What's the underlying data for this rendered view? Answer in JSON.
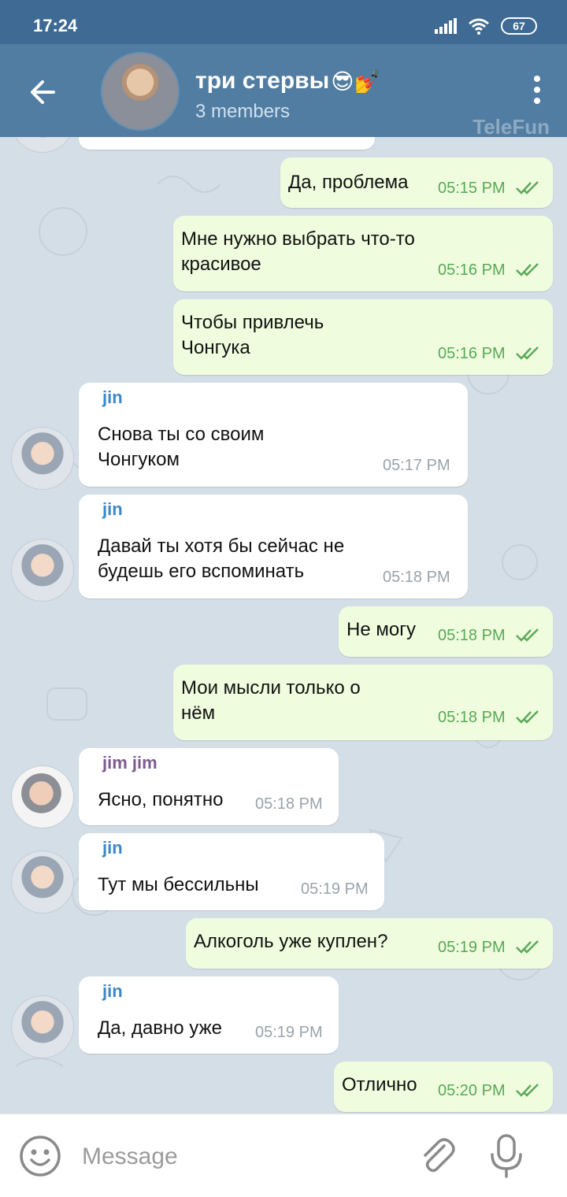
{
  "status": {
    "time": "17:24",
    "battery": "67"
  },
  "header": {
    "title": "три стервы",
    "title_emojis": "😎💅",
    "subtitle": "3 members",
    "watermark": "TeleFun"
  },
  "messages": [
    {
      "text": "Да, проблема",
      "time": "05:15 PM"
    },
    {
      "text": "Мне нужно выбрать что-то\nкрасивое",
      "time": "05:16 PM"
    },
    {
      "text": "Чтобы привлечь\nЧонгука",
      "time": "05:16 PM"
    },
    {
      "sender": "jin",
      "text": "Снова ты со своим\nЧонгуком",
      "time": "05:17 PM"
    },
    {
      "sender": "jin",
      "text": "Давай ты хотя бы сейчас не\nбудешь его вспоминать",
      "time": "05:18 PM"
    },
    {
      "text": "Не могу",
      "time": "05:18 PM"
    },
    {
      "text": "Мои мысли только о\nнём",
      "time": "05:18 PM"
    },
    {
      "sender": "jim jim",
      "text": "Ясно, понятно",
      "time": "05:18 PM"
    },
    {
      "sender": "jin",
      "text": "Тут мы бессильны",
      "time": "05:19 PM"
    },
    {
      "text": "Алкоголь уже куплен?",
      "time": "05:19 PM"
    },
    {
      "sender": "jin",
      "text": "Да, давно уже",
      "time": "05:19 PM"
    },
    {
      "text": "Отлично",
      "time": "05:20 PM"
    }
  ],
  "composer": {
    "placeholder": "Message"
  },
  "colors": {
    "header": "#517da2",
    "statusbar": "#3e6a93",
    "outgoing": "#effdde",
    "incoming": "#ffffff",
    "tick": "#59a857"
  }
}
